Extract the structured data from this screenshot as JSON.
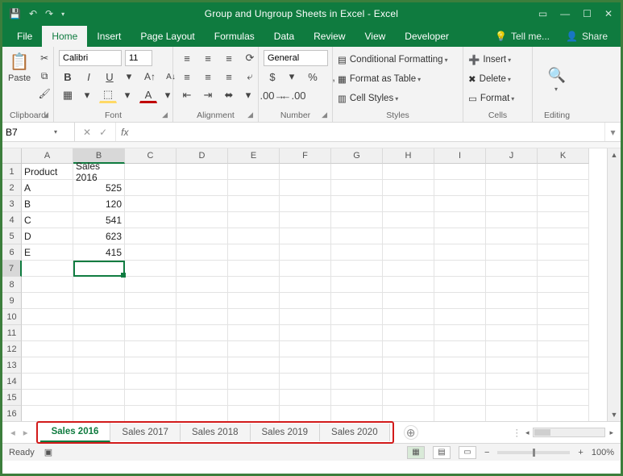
{
  "title": "Group and Ungroup Sheets in Excel - Excel",
  "menus": {
    "file": "File",
    "home": "Home",
    "insert": "Insert",
    "pageLayout": "Page Layout",
    "formulas": "Formulas",
    "data": "Data",
    "review": "Review",
    "view": "View",
    "developer": "Developer",
    "tell": "Tell me...",
    "share": "Share"
  },
  "ribbon": {
    "clipboard": "Clipboard",
    "paste": "Paste",
    "font": "Font",
    "fontName": "Calibri",
    "fontSize": "11",
    "alignment": "Alignment",
    "number": "Number",
    "numberFormat": "General",
    "styles": "Styles",
    "cf": "Conditional Formatting",
    "fat": "Format as Table",
    "cs": "Cell Styles",
    "cells": "Cells",
    "ins": "Insert",
    "del": "Delete",
    "fmt": "Format",
    "editing": "Editing"
  },
  "namebox": "B7",
  "formula": "",
  "columns": [
    "A",
    "B",
    "C",
    "D",
    "E",
    "F",
    "G",
    "H",
    "I",
    "J",
    "K"
  ],
  "rows": [
    "1",
    "2",
    "3",
    "4",
    "5",
    "6",
    "7",
    "8",
    "9",
    "10",
    "11",
    "12",
    "13",
    "14",
    "15",
    "16"
  ],
  "activeCol": 1,
  "activeRow": 6,
  "data": {
    "headers": [
      "Product",
      "Sales 2016"
    ],
    "rows": [
      {
        "p": "A",
        "v": "525"
      },
      {
        "p": "B",
        "v": "120"
      },
      {
        "p": "C",
        "v": "541"
      },
      {
        "p": "D",
        "v": "623"
      },
      {
        "p": "E",
        "v": "415"
      }
    ]
  },
  "sheetTabs": [
    "Sales 2016",
    "Sales 2017",
    "Sales 2018",
    "Sales 2019",
    "Sales 2020"
  ],
  "activeSheet": 0,
  "status": {
    "ready": "Ready",
    "zoom": "100%"
  }
}
